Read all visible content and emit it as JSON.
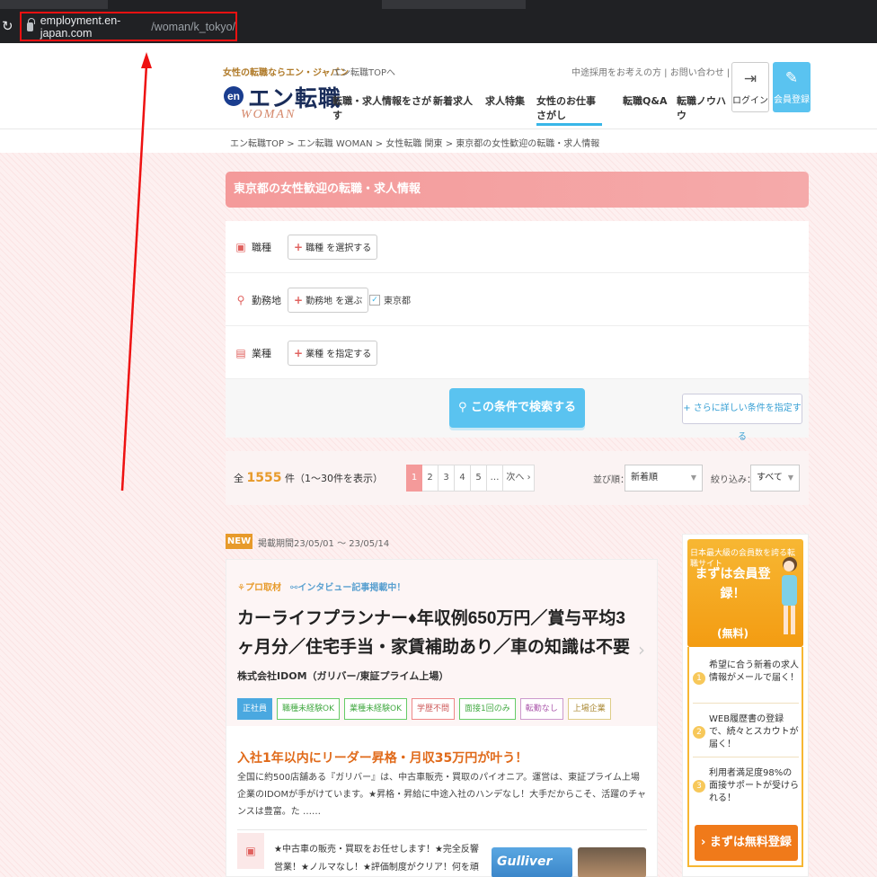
{
  "browser": {
    "url_host": "employment.en-japan.com",
    "url_path": "/woman/k_tokyo/"
  },
  "header": {
    "tagline": "女性の転職ならエン・ジャパン",
    "logo_en": "en",
    "logo_title": "エン転職",
    "logo_woman": "WOMAN",
    "top_link": "エン転職TOPへ",
    "util_links": "中途採用をお考えの方 | お問い合わせ | ヘルプ",
    "nav": [
      "転職・求人情報をさがす",
      "新着求人",
      "求人特集",
      "女性のお仕事さがし",
      "転職Q&A",
      "転職ノウハウ"
    ],
    "login": "ログイン",
    "register": "会員登録"
  },
  "breadcrumb": "エン転職TOP > エン転職 WOMAN > 女性転職 関東 > 東京都の女性歓迎の転職・求人情報",
  "search": {
    "title": "東京都の女性歓迎の転職・求人情報",
    "rows": [
      {
        "label": "職種",
        "button": "職種",
        "button_suffix": "を選択する"
      },
      {
        "label": "勤務地",
        "button": "勤務地",
        "button_suffix": "を選ぶ",
        "chip": "東京都"
      },
      {
        "label": "業種",
        "button": "業種",
        "button_suffix": "を指定する"
      }
    ],
    "submit": "この条件で検索する",
    "more": "さらに詳しい条件を指定する"
  },
  "results": {
    "prefix": "全",
    "count": "1555",
    "suffix": "件（1〜30件を表示）",
    "pages": [
      "1",
      "2",
      "3",
      "4",
      "5",
      "…",
      "次へ ›"
    ],
    "sort_label": "並び順：",
    "sort_value": "新着順",
    "filter_label": "絞り込み：",
    "filter_value": "すべて"
  },
  "job": {
    "new_badge": "NEW",
    "period": "掲載期間23/05/01 〜 23/05/14",
    "tag_pro": "プロ取材",
    "tag_interview": "インタビュー記事掲載中！",
    "title": "カーライフプランナー♦年収例650万円／賞与平均3ヶ月分／住宅手当・家賃補助あり／車の知識は不要",
    "company": "株式会社IDOM（ガリバー/東証プライム上場）",
    "badges": [
      "正社員",
      "職種未経験OK",
      "業種未経験OK",
      "学歴不問",
      "面接1回のみ",
      "転勤なし",
      "上場企業"
    ],
    "catch": "入社1年以内にリーダー昇格・月収35万円が叶う！",
    "desc": "全国に約500店舗ある『ガリバー』は、中古車販売・買取のパイオニア。運営は、東証プライム上場企業のIDOMが手がけています。★昇格・昇給に中途入社のハンデなし！大手だからこそ、活躍のチャンスは豊富。た ……",
    "feature": "★中古車の販売・買取をお任せします！★完全反響営業！★ノルマなし！★評価制度がクリア！何を頑張ればいいの",
    "thumb_text": "Gulliver"
  },
  "side_banner": {
    "sub": "日本最大級の会員数を誇る転職サイト",
    "main": "まずは会員登録！",
    "free": "(無料)",
    "items": [
      {
        "n": "1",
        "text": "希望に合う新着の求人情報がメールで届く！"
      },
      {
        "n": "2",
        "text": "WEB履歴書の登録で、続々とスカウトが届く！"
      },
      {
        "n": "3",
        "text": "利用者満足度98%の面接サポートが受けられる！"
      }
    ],
    "cta": "› まずは無料登録"
  },
  "colors": {
    "accent_blue": "#5ac3f0",
    "header_pink": "#f49a9a",
    "orange": "#e79a2a",
    "annotation_red": "#ee1111"
  }
}
